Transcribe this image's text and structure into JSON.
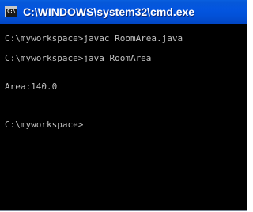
{
  "window": {
    "title": "C:\\WINDOWS\\system32\\cmd.exe",
    "icon_name": "cmd-icon",
    "icon_text": "C:\\"
  },
  "console": {
    "lines": [
      "C:\\myworkspace>javac RoomArea.java",
      "C:\\myworkspace>java RoomArea",
      "Area:140.0",
      "C:\\myworkspace>"
    ]
  },
  "colors": {
    "titlebar": "#0355e0",
    "console_bg": "#000000",
    "console_text": "#c0c0c0",
    "title_text": "#ffffff"
  }
}
